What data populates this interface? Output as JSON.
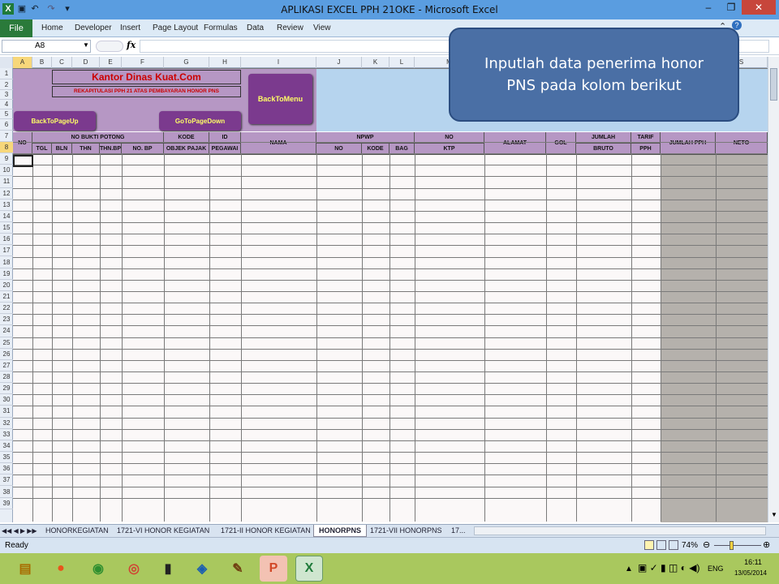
{
  "window": {
    "title": "APLIKASI EXCEL PPH 21OKE - Microsoft Excel",
    "min": "–",
    "restore": "❐",
    "close": "✕"
  },
  "ribbon": {
    "file": "File",
    "tabs": [
      "Home",
      "Developer",
      "Insert",
      "Page Layout",
      "Formulas",
      "Data",
      "Review",
      "View"
    ]
  },
  "formula_bar": {
    "name_box": "A8",
    "fx": "fx",
    "value": ""
  },
  "columns": [
    "A",
    "B",
    "C",
    "D",
    "E",
    "F",
    "G",
    "H",
    "I",
    "J",
    "K",
    "L",
    "M",
    "S"
  ],
  "rows": [
    "1",
    "2",
    "3",
    "4",
    "5",
    "6",
    "7",
    "8",
    "9",
    "10",
    "11",
    "12",
    "13",
    "14",
    "15",
    "16",
    "17",
    "18",
    "19",
    "20",
    "21",
    "22",
    "23",
    "24",
    "25",
    "26",
    "27",
    "28",
    "29",
    "30",
    "31",
    "32",
    "33",
    "34",
    "35",
    "36",
    "37",
    "38",
    "39"
  ],
  "sheet_header": {
    "office": "Kantor Dinas Kuat.Com",
    "subtitle": "REKAPITULASI PPH 21 ATAS PEMBAYARAN HONOR PNS",
    "btn_back_menu": "BackToMenu",
    "btn_page_up": "BackToPageUp",
    "btn_page_down": "GoToPageDown"
  },
  "table_headers": {
    "no": "NO",
    "no_bukti": "NO BUKTI POTONG",
    "tgl": "TGL",
    "bln": "BLN",
    "thn": "THN",
    "thn_bp": "THN.BP",
    "no_bp": "NO. BP",
    "kode": "KODE",
    "objek_pajak": "OBJEK PAJAK",
    "id": "ID",
    "pegawai": "PEGAWAI",
    "nama": "NAMA",
    "npwp": "NPWP",
    "npwp_no": "NO",
    "npwp_kode": "KODE",
    "npwp_bag": "BAG",
    "no_ktp1": "NO",
    "no_ktp2": "KTP",
    "alamat": "ALAMAT",
    "gol": "GOL",
    "jumlah": "JUMLAH",
    "bruto": "BRUTO",
    "tarif": "TARIF",
    "pph": "PPH",
    "jumlah_pph": "JUMLAH PPH",
    "neto": "NETO"
  },
  "callout": {
    "line1": "Inputlah data penerima honor",
    "line2": "PNS pada kolom berikut"
  },
  "sheet_tabs": [
    "HONORKEGIATAN",
    "1721-VI HONOR KEGIATAN",
    "1721-II HONOR KEGIATAN",
    "HONORPNS",
    "1721-VII HONORPNS",
    "17..."
  ],
  "active_tab": "HONORPNS",
  "status": {
    "ready": "Ready",
    "zoom": "74%"
  },
  "taskbar": {
    "lang": "ENG",
    "time": "16:11",
    "date": "13/05/2014"
  },
  "colors": {
    "header_purple": "#b697c4",
    "button_purple": "#7b3a8e",
    "callout_blue": "#4a6fa5",
    "excel_green": "#2a7a3a"
  }
}
